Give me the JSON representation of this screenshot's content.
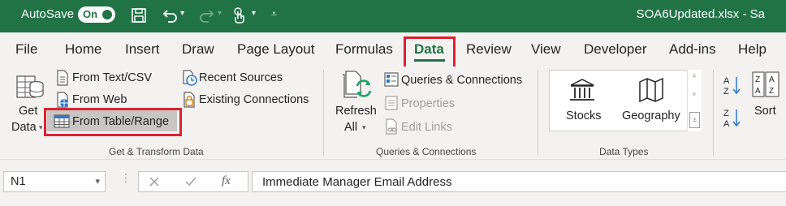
{
  "titlebar": {
    "autosave_label": "AutoSave",
    "autosave_state": "On",
    "filename": "SOA6Updated.xlsx  -  Sa",
    "icons": [
      "save-icon",
      "undo-icon",
      "redo-icon",
      "touch-mode-icon",
      "customize-qat-icon"
    ]
  },
  "tabs": {
    "file": "File",
    "home": "Home",
    "insert": "Insert",
    "draw": "Draw",
    "page_layout": "Page Layout",
    "formulas": "Formulas",
    "data": "Data",
    "review": "Review",
    "view": "View",
    "developer": "Developer",
    "addins": "Add-ins",
    "help": "Help"
  },
  "ribbon": {
    "get_transform": {
      "get_data_line1": "Get",
      "get_data_line2": "Data",
      "from_text_csv": "From Text/CSV",
      "from_web": "From Web",
      "from_table_range": "From Table/Range",
      "recent_sources": "Recent Sources",
      "existing_connections": "Existing Connections",
      "group_label": "Get & Transform Data"
    },
    "queries": {
      "refresh_line1": "Refresh",
      "refresh_line2": "All",
      "queries_connections": "Queries & Connections",
      "properties": "Properties",
      "edit_links": "Edit Links",
      "group_label": "Queries & Connections"
    },
    "data_types": {
      "stocks": "Stocks",
      "geography": "Geography",
      "group_label": "Data Types"
    },
    "sort_filter": {
      "sort_az": "A Z",
      "sort_za": "Z A",
      "sort": "Sort"
    }
  },
  "formula_bar": {
    "name_box": "N1",
    "fx_label": "fx",
    "formula_value": "Immediate Manager Email Address"
  },
  "colors": {
    "excel_green": "#217346",
    "highlight_red": "#d9232f"
  }
}
